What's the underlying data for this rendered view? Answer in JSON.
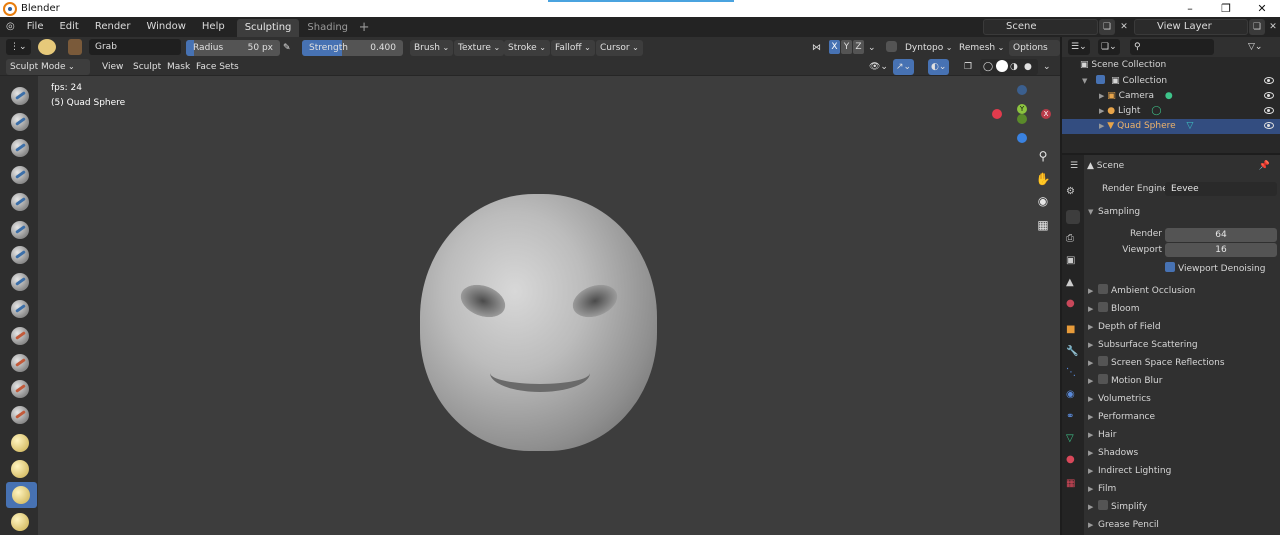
{
  "window": {
    "title": "Blender"
  },
  "menu": [
    "File",
    "Edit",
    "Render",
    "Window",
    "Help"
  ],
  "workspaces": [
    {
      "label": "Sculpting",
      "active": true
    },
    {
      "label": "Shading",
      "active": false
    }
  ],
  "scene": {
    "name": "Scene",
    "view_layer": "View Layer"
  },
  "tool_header": {
    "brush_name": "Grab",
    "radius": {
      "label": "Radius",
      "value": "50 px"
    },
    "strength": {
      "label": "Strength",
      "value": "0.400",
      "fraction": 0.4
    },
    "menus": [
      "Brush",
      "Texture",
      "Stroke",
      "Falloff",
      "Cursor"
    ],
    "axes": [
      "X",
      "Y",
      "Z"
    ],
    "dyntopo": "Dyntopo",
    "remesh": "Remesh",
    "options": "Options"
  },
  "mode_header": {
    "mode": "Sculpt Mode",
    "menus": [
      "View",
      "Sculpt",
      "Mask",
      "Face Sets"
    ]
  },
  "viewport": {
    "fps": "fps: 24",
    "object": "(5) Quad Sphere",
    "gizmo": {
      "x": "X",
      "y": "Y",
      "z": "Z"
    }
  },
  "outliner": {
    "root": "Scene Collection",
    "items": [
      {
        "label": "Collection",
        "level": 1,
        "selected": false
      },
      {
        "label": "Camera",
        "level": 2,
        "selected": false
      },
      {
        "label": "Light",
        "level": 2,
        "selected": false
      },
      {
        "label": "Quad Sphere",
        "level": 2,
        "selected": true
      }
    ]
  },
  "properties": {
    "context": "Scene",
    "render_engine_label": "Render Engine",
    "render_engine_value": "Eevee",
    "sampling": {
      "label": "Sampling",
      "render_label": "Render",
      "render_value": "64",
      "viewport_label": "Viewport",
      "viewport_value": "16",
      "denoise_label": "Viewport Denoising"
    },
    "panels": [
      {
        "label": "Ambient Occlusion",
        "checkbox": true
      },
      {
        "label": "Bloom",
        "checkbox": true
      },
      {
        "label": "Depth of Field",
        "checkbox": false
      },
      {
        "label": "Subsurface Scattering",
        "checkbox": false
      },
      {
        "label": "Screen Space Reflections",
        "checkbox": true
      },
      {
        "label": "Motion Blur",
        "checkbox": true
      },
      {
        "label": "Volumetrics",
        "checkbox": false
      },
      {
        "label": "Performance",
        "checkbox": false
      },
      {
        "label": "Hair",
        "checkbox": false
      },
      {
        "label": "Shadows",
        "checkbox": false
      },
      {
        "label": "Indirect Lighting",
        "checkbox": false
      },
      {
        "label": "Film",
        "checkbox": false
      },
      {
        "label": "Simplify",
        "checkbox": true
      },
      {
        "label": "Grease Pencil",
        "checkbox": false
      }
    ]
  },
  "colors": {
    "accent": "#4772b3",
    "selection": "#334d80",
    "gizmo_x": "#e23b4d",
    "gizmo_y": "#8cc43f",
    "gizmo_z": "#3a82e0"
  }
}
